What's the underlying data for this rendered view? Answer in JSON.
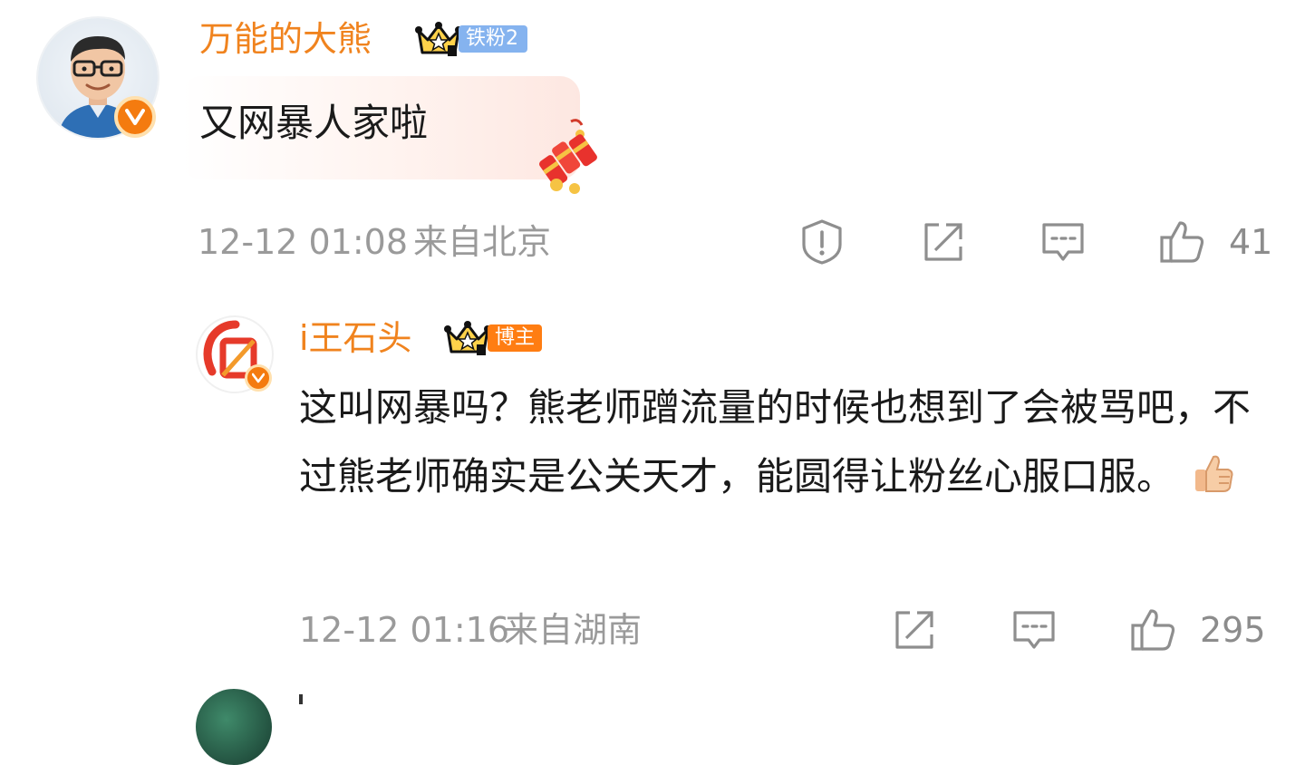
{
  "comments": [
    {
      "username": "万能的大熊",
      "fan_level": "铁粉2",
      "text": "又网暴人家啦",
      "time": "12-12 01:08",
      "location": "来自北京",
      "likes": "41",
      "icons": [
        "report-icon",
        "share-icon",
        "comment-icon",
        "like-icon"
      ]
    },
    {
      "username": "i王石头",
      "badge": "博主",
      "text": "这叫网暴吗？熊老师蹭流量的时候也想到了会被骂吧，不过熊老师确实是公关天才，能圆得让粉丝心服口服。",
      "time": "12-12 01:16",
      "location": "来自湖南",
      "likes": "295",
      "icons": [
        "share-icon",
        "comment-icon",
        "like-icon"
      ]
    }
  ],
  "colors": {
    "username": "#f0831e",
    "fan_badge": "#85b3ef",
    "host_badge": "#ff7d12",
    "meta_text": "#9a9a9a",
    "verified": "#f47b0f"
  }
}
